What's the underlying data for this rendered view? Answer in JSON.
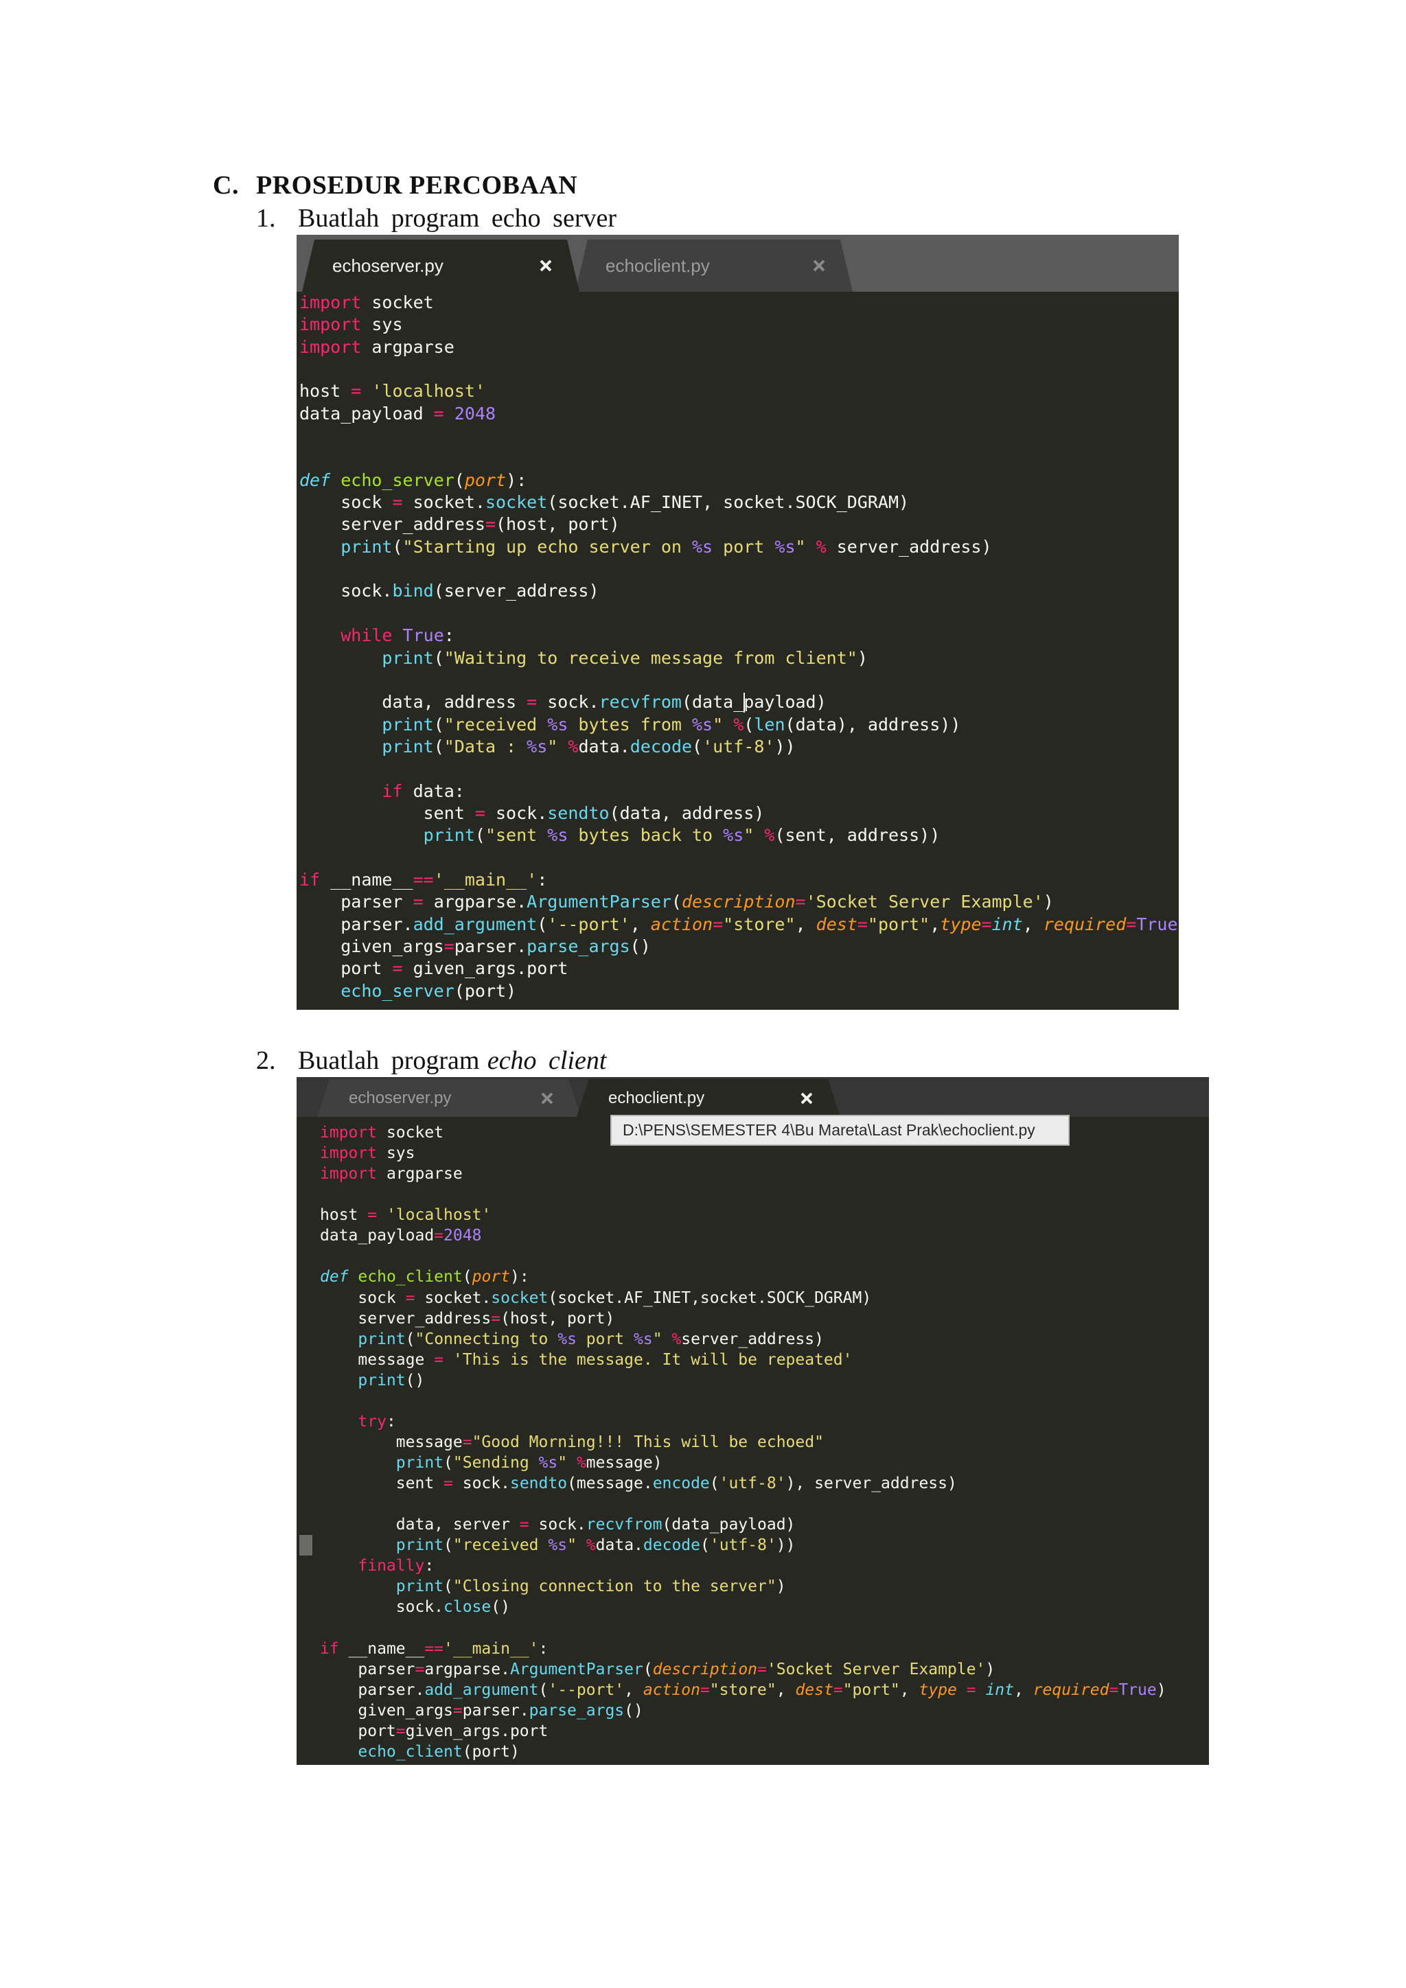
{
  "section": {
    "letter": "C.",
    "title": "PROSEDUR PERCOBAAN"
  },
  "steps": [
    {
      "number": "1.",
      "text": "Buatlah program echo server"
    },
    {
      "number": "2.",
      "text": "Buatlah program",
      "emphasis": "echo client"
    }
  ],
  "theme": {
    "code-bg": "#272822",
    "text": "#f8f8f2",
    "keyword": "#f92672",
    "string": "#e6db74",
    "number": "#ae81ff",
    "function": "#66d9ef",
    "param": "#fd971f",
    "defname": "#a6e22e",
    "tab-inactive-bg": "#404040",
    "tab-active-text": "#f2f2f2",
    "tab-inactive-text": "#9c9c9c",
    "tooltip-bg": "#ececec"
  },
  "editor1": {
    "tabbar_bg": "#5a5a5a",
    "tabs": [
      {
        "label": "echoserver.py",
        "active": true,
        "icon": "close-icon"
      },
      {
        "label": "echoclient.py",
        "active": false,
        "icon": "close-icon"
      }
    ],
    "lines": [
      [
        [
          "import",
          "k"
        ],
        [
          " socket",
          "t"
        ]
      ],
      [
        [
          "import",
          "k"
        ],
        [
          " sys",
          "t"
        ]
      ],
      [
        [
          "import",
          "k"
        ],
        [
          " argparse",
          "t"
        ]
      ],
      [],
      [
        [
          "host ",
          "t"
        ],
        [
          "=",
          "o"
        ],
        [
          " ",
          "t"
        ],
        [
          "'localhost'",
          "s"
        ]
      ],
      [
        [
          "data_payload ",
          "t"
        ],
        [
          "=",
          "o"
        ],
        [
          " ",
          "t"
        ],
        [
          "2048",
          "n"
        ]
      ],
      [],
      [],
      [
        [
          "def",
          "d"
        ],
        [
          " ",
          "t"
        ],
        [
          "echo_server",
          "g"
        ],
        [
          "(",
          "t"
        ],
        [
          "port",
          "p"
        ],
        [
          "):",
          "t"
        ]
      ],
      [
        [
          "    sock ",
          "t"
        ],
        [
          "=",
          "o"
        ],
        [
          " socket.",
          "t"
        ],
        [
          "socket",
          "f"
        ],
        [
          "(socket.AF_INET, socket.SOCK_DGRAM)",
          "t"
        ]
      ],
      [
        [
          "    server_address",
          "t"
        ],
        [
          "=",
          "o"
        ],
        [
          "(host, port)",
          "t"
        ]
      ],
      [
        [
          "    ",
          "t"
        ],
        [
          "print",
          "f"
        ],
        [
          "(",
          "t"
        ],
        [
          "\"Starting up echo server on ",
          "s"
        ],
        [
          "%s",
          "c"
        ],
        [
          " port ",
          "s"
        ],
        [
          "%s",
          "c"
        ],
        [
          "\"",
          "s"
        ],
        [
          " ",
          "t"
        ],
        [
          "%",
          "o"
        ],
        [
          " server_address)",
          "t"
        ]
      ],
      [],
      [
        [
          "    sock.",
          "t"
        ],
        [
          "bind",
          "f"
        ],
        [
          "(server_address)",
          "t"
        ]
      ],
      [],
      [
        [
          "    ",
          "t"
        ],
        [
          "while",
          "k"
        ],
        [
          " ",
          "t"
        ],
        [
          "True",
          "c"
        ],
        [
          ":",
          "t"
        ]
      ],
      [
        [
          "        ",
          "t"
        ],
        [
          "print",
          "f"
        ],
        [
          "(",
          "t"
        ],
        [
          "\"Waiting to receive message from client\"",
          "s"
        ],
        [
          ")",
          "t"
        ]
      ],
      [],
      [
        [
          "        data, address ",
          "t"
        ],
        [
          "=",
          "o"
        ],
        [
          " sock.",
          "t"
        ],
        [
          "recvfrom",
          "f"
        ],
        [
          "(data_payload)",
          "t"
        ]
      ],
      [
        [
          "        ",
          "t"
        ],
        [
          "print",
          "f"
        ],
        [
          "(",
          "t"
        ],
        [
          "\"received ",
          "s"
        ],
        [
          "%s",
          "c"
        ],
        [
          " bytes from ",
          "s"
        ],
        [
          "%s",
          "c"
        ],
        [
          "\"",
          "s"
        ],
        [
          " ",
          "t"
        ],
        [
          "%",
          "o"
        ],
        [
          "(",
          "t"
        ],
        [
          "len",
          "f"
        ],
        [
          "(data), address))",
          "t"
        ]
      ],
      [
        [
          "        ",
          "t"
        ],
        [
          "print",
          "f"
        ],
        [
          "(",
          "t"
        ],
        [
          "\"Data : ",
          "s"
        ],
        [
          "%s",
          "c"
        ],
        [
          "\"",
          "s"
        ],
        [
          " ",
          "t"
        ],
        [
          "%",
          "o"
        ],
        [
          "data.",
          "t"
        ],
        [
          "decode",
          "f"
        ],
        [
          "(",
          "t"
        ],
        [
          "'utf-8'",
          "s"
        ],
        [
          "))",
          "t"
        ]
      ],
      [],
      [
        [
          "        ",
          "t"
        ],
        [
          "if",
          "k"
        ],
        [
          " data:",
          "t"
        ]
      ],
      [
        [
          "            sent ",
          "t"
        ],
        [
          "=",
          "o"
        ],
        [
          " sock.",
          "t"
        ],
        [
          "sendto",
          "f"
        ],
        [
          "(data, address)",
          "t"
        ]
      ],
      [
        [
          "            ",
          "t"
        ],
        [
          "print",
          "f"
        ],
        [
          "(",
          "t"
        ],
        [
          "\"sent ",
          "s"
        ],
        [
          "%s",
          "c"
        ],
        [
          " bytes back to ",
          "s"
        ],
        [
          "%s",
          "c"
        ],
        [
          "\"",
          "s"
        ],
        [
          " ",
          "t"
        ],
        [
          "%",
          "o"
        ],
        [
          "(sent, address))",
          "t"
        ]
      ],
      [],
      [
        [
          "if",
          "k"
        ],
        [
          " __name__",
          "t"
        ],
        [
          "==",
          "o"
        ],
        [
          "'__main__'",
          "s"
        ],
        [
          ":",
          "t"
        ]
      ],
      [
        [
          "    parser ",
          "t"
        ],
        [
          "=",
          "o"
        ],
        [
          " argparse.",
          "t"
        ],
        [
          "ArgumentParser",
          "f"
        ],
        [
          "(",
          "t"
        ],
        [
          "description",
          "p"
        ],
        [
          "=",
          "o"
        ],
        [
          "'Socket Server Example'",
          "s"
        ],
        [
          ")",
          "t"
        ]
      ],
      [
        [
          "    parser.",
          "t"
        ],
        [
          "add_argument",
          "f"
        ],
        [
          "(",
          "t"
        ],
        [
          "'--port'",
          "s"
        ],
        [
          ", ",
          "t"
        ],
        [
          "action",
          "p"
        ],
        [
          "=",
          "o"
        ],
        [
          "\"store\"",
          "s"
        ],
        [
          ", ",
          "t"
        ],
        [
          "dest",
          "p"
        ],
        [
          "=",
          "o"
        ],
        [
          "\"port\"",
          "s"
        ],
        [
          ",",
          "t"
        ],
        [
          "type",
          "p"
        ],
        [
          "=",
          "o"
        ],
        [
          "int",
          "fi"
        ],
        [
          ", ",
          "t"
        ],
        [
          "required",
          "p"
        ],
        [
          "=",
          "o"
        ],
        [
          "True",
          "c"
        ]
      ],
      [
        [
          "    given_args",
          "t"
        ],
        [
          "=",
          "o"
        ],
        [
          "parser.",
          "t"
        ],
        [
          "parse_args",
          "f"
        ],
        [
          "()",
          "t"
        ]
      ],
      [
        [
          "    port ",
          "t"
        ],
        [
          "=",
          "o"
        ],
        [
          " given_args.port",
          "t"
        ]
      ],
      [
        [
          "    ",
          "t"
        ],
        [
          "echo_server",
          "f"
        ],
        [
          "(port)",
          "t"
        ]
      ]
    ]
  },
  "editor2": {
    "tabbar_bg": "#363636",
    "tooltip": "D:\\PENS\\SEMESTER 4\\Bu Mareta\\Last Prak\\echoclient.py",
    "tabs": [
      {
        "label": "echoserver.py",
        "active": false,
        "icon": "close-icon"
      },
      {
        "label": "echoclient.py",
        "active": true,
        "icon": "close-icon"
      }
    ],
    "lines": [
      [
        [
          "import",
          "k"
        ],
        [
          " socket",
          "t"
        ]
      ],
      [
        [
          "import",
          "k"
        ],
        [
          " sys",
          "t"
        ]
      ],
      [
        [
          "import",
          "k"
        ],
        [
          " argparse",
          "t"
        ]
      ],
      [],
      [
        [
          "host ",
          "t"
        ],
        [
          "=",
          "o"
        ],
        [
          " ",
          "t"
        ],
        [
          "'localhost'",
          "s"
        ]
      ],
      [
        [
          "data_payload",
          "t"
        ],
        [
          "=",
          "o"
        ],
        [
          "2048",
          "n"
        ]
      ],
      [],
      [
        [
          "def",
          "d"
        ],
        [
          " ",
          "t"
        ],
        [
          "echo_client",
          "g"
        ],
        [
          "(",
          "t"
        ],
        [
          "port",
          "p"
        ],
        [
          "):",
          "t"
        ]
      ],
      [
        [
          "    sock ",
          "t"
        ],
        [
          "=",
          "o"
        ],
        [
          " socket.",
          "t"
        ],
        [
          "socket",
          "f"
        ],
        [
          "(socket.AF_INET,socket.SOCK_DGRAM)",
          "t"
        ]
      ],
      [
        [
          "    server_address",
          "t"
        ],
        [
          "=",
          "o"
        ],
        [
          "(host, port)",
          "t"
        ]
      ],
      [
        [
          "    ",
          "t"
        ],
        [
          "print",
          "f"
        ],
        [
          "(",
          "t"
        ],
        [
          "\"Connecting to ",
          "s"
        ],
        [
          "%s",
          "c"
        ],
        [
          " port ",
          "s"
        ],
        [
          "%s",
          "c"
        ],
        [
          "\"",
          "s"
        ],
        [
          " ",
          "t"
        ],
        [
          "%",
          "o"
        ],
        [
          "server_address)",
          "t"
        ]
      ],
      [
        [
          "    message ",
          "t"
        ],
        [
          "=",
          "o"
        ],
        [
          " ",
          "t"
        ],
        [
          "'This is the message. It will be repeated'",
          "s"
        ]
      ],
      [
        [
          "    ",
          "t"
        ],
        [
          "print",
          "f"
        ],
        [
          "()",
          "t"
        ]
      ],
      [],
      [
        [
          "    ",
          "t"
        ],
        [
          "try",
          "k"
        ],
        [
          ":",
          "t"
        ]
      ],
      [
        [
          "        message",
          "t"
        ],
        [
          "=",
          "o"
        ],
        [
          "\"Good Morning!!! This will be echoed\"",
          "s"
        ]
      ],
      [
        [
          "        ",
          "t"
        ],
        [
          "print",
          "f"
        ],
        [
          "(",
          "t"
        ],
        [
          "\"Sending ",
          "s"
        ],
        [
          "%s",
          "c"
        ],
        [
          "\"",
          "s"
        ],
        [
          " ",
          "t"
        ],
        [
          "%",
          "o"
        ],
        [
          "message)",
          "t"
        ]
      ],
      [
        [
          "        sent ",
          "t"
        ],
        [
          "=",
          "o"
        ],
        [
          " sock.",
          "t"
        ],
        [
          "sendto",
          "f"
        ],
        [
          "(message.",
          "t"
        ],
        [
          "encode",
          "f"
        ],
        [
          "(",
          "t"
        ],
        [
          "'utf-8'",
          "s"
        ],
        [
          "), server_address)",
          "t"
        ]
      ],
      [],
      [
        [
          "        data, server ",
          "t"
        ],
        [
          "=",
          "o"
        ],
        [
          " sock.",
          "t"
        ],
        [
          "recvfrom",
          "f"
        ],
        [
          "(data_payload)",
          "t"
        ]
      ],
      [
        [
          "        ",
          "t"
        ],
        [
          "print",
          "f"
        ],
        [
          "(",
          "t"
        ],
        [
          "\"received ",
          "s"
        ],
        [
          "%s",
          "c"
        ],
        [
          "\"",
          "s"
        ],
        [
          " ",
          "t"
        ],
        [
          "%",
          "o"
        ],
        [
          "data.",
          "t"
        ],
        [
          "decode",
          "f"
        ],
        [
          "(",
          "t"
        ],
        [
          "'utf-8'",
          "s"
        ],
        [
          "))",
          "t"
        ]
      ],
      [
        [
          "    ",
          "t"
        ],
        [
          "finally",
          "k"
        ],
        [
          ":",
          "t"
        ]
      ],
      [
        [
          "        ",
          "t"
        ],
        [
          "print",
          "f"
        ],
        [
          "(",
          "t"
        ],
        [
          "\"Closing connection to the server\"",
          "s"
        ],
        [
          ")",
          "t"
        ]
      ],
      [
        [
          "        sock.",
          "t"
        ],
        [
          "close",
          "f"
        ],
        [
          "()",
          "t"
        ]
      ],
      [],
      [
        [
          "if",
          "k"
        ],
        [
          " __name__",
          "t"
        ],
        [
          "==",
          "o"
        ],
        [
          "'__main__'",
          "s"
        ],
        [
          ":",
          "t"
        ]
      ],
      [
        [
          "    parser",
          "t"
        ],
        [
          "=",
          "o"
        ],
        [
          "argparse.",
          "t"
        ],
        [
          "ArgumentParser",
          "f"
        ],
        [
          "(",
          "t"
        ],
        [
          "description",
          "p"
        ],
        [
          "=",
          "o"
        ],
        [
          "'Socket Server Example'",
          "s"
        ],
        [
          ")",
          "t"
        ]
      ],
      [
        [
          "    parser.",
          "t"
        ],
        [
          "add_argument",
          "f"
        ],
        [
          "(",
          "t"
        ],
        [
          "'--port'",
          "s"
        ],
        [
          ", ",
          "t"
        ],
        [
          "action",
          "p"
        ],
        [
          "=",
          "o"
        ],
        [
          "\"store\"",
          "s"
        ],
        [
          ", ",
          "t"
        ],
        [
          "dest",
          "p"
        ],
        [
          "=",
          "o"
        ],
        [
          "\"port\"",
          "s"
        ],
        [
          ", ",
          "t"
        ],
        [
          "type",
          "p"
        ],
        [
          " ",
          "t"
        ],
        [
          "=",
          "o"
        ],
        [
          " ",
          "t"
        ],
        [
          "int",
          "fi"
        ],
        [
          ", ",
          "t"
        ],
        [
          "required",
          "p"
        ],
        [
          "=",
          "o"
        ],
        [
          "True",
          "c"
        ],
        [
          ")",
          "t"
        ]
      ],
      [
        [
          "    given_args",
          "t"
        ],
        [
          "=",
          "o"
        ],
        [
          "parser.",
          "t"
        ],
        [
          "parse_args",
          "f"
        ],
        [
          "()",
          "t"
        ]
      ],
      [
        [
          "    port",
          "t"
        ],
        [
          "=",
          "o"
        ],
        [
          "given_args.port",
          "t"
        ]
      ],
      [
        [
          "    ",
          "t"
        ],
        [
          "echo_client",
          "f"
        ],
        [
          "(port)",
          "t"
        ]
      ]
    ]
  }
}
